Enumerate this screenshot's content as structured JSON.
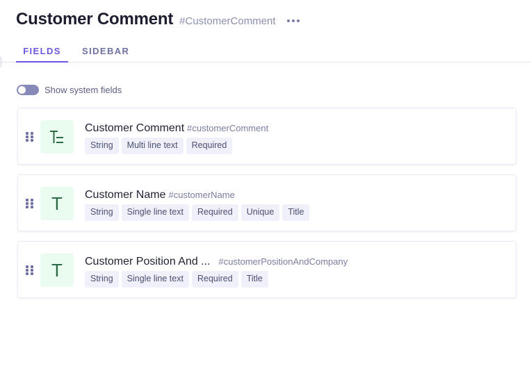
{
  "header": {
    "title": "Customer Comment",
    "api_id": "#CustomerComment",
    "more_icon": "more-horizontal-icon"
  },
  "tabs": [
    {
      "label": "FIELDS",
      "active": true
    },
    {
      "label": "SIDEBAR",
      "active": false
    }
  ],
  "system_fields_toggle": {
    "label": "Show system fields",
    "enabled": false
  },
  "fields": [
    {
      "name": "Customer Comment",
      "api_id": "#customerComment",
      "icon": "multi-line-text-icon",
      "badges": [
        "String",
        "Multi line text",
        "Required"
      ]
    },
    {
      "name": "Customer Name",
      "api_id": "#customerName",
      "icon": "single-line-text-icon",
      "badges": [
        "String",
        "Single line text",
        "Required",
        "Unique",
        "Title"
      ]
    },
    {
      "name": "Customer Position And ...",
      "api_id": "#customerPositionAndCompany",
      "icon": "single-line-text-icon",
      "badges": [
        "String",
        "Single line text",
        "Required",
        "Title"
      ]
    }
  ],
  "colors": {
    "accent": "#6f55e0",
    "icon_bg": "#eafcef",
    "icon_fg": "#2d6b45",
    "badge_bg": "#f0f0fa"
  }
}
